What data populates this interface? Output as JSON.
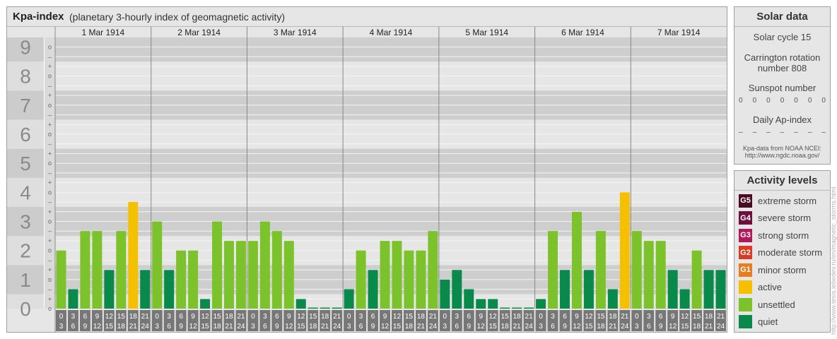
{
  "header": {
    "title": "Kpa-index",
    "subtitle": "(planetary 3-hourly index of geomagnetic activity)"
  },
  "solar": {
    "title": "Solar data",
    "cycle": "Solar cycle 15",
    "carrington_line1": "Carrington rotation",
    "carrington_line2": "number 808",
    "sunspot_label": "Sunspot number",
    "sunspot_values": [
      "0",
      "0",
      "0",
      "0",
      "0",
      "0",
      "0"
    ],
    "ap_label": "Daily Ap-index",
    "ap_values": [
      "–",
      "–",
      "–",
      "–",
      "–",
      "–",
      "–"
    ],
    "source_line1": "Kpa-data from NOAA NCEI:",
    "source_line2": "http://www.ngdc.noaa.gov/"
  },
  "activity": {
    "title": "Activity levels",
    "levels": [
      {
        "badge": "G5",
        "label": "extreme storm",
        "color": "#4a0a24"
      },
      {
        "badge": "G4",
        "label": "severe storm",
        "color": "#6e0f3e"
      },
      {
        "badge": "G3",
        "label": "strong storm",
        "color": "#b0185a"
      },
      {
        "badge": "G2",
        "label": "moderate storm",
        "color": "#d83a22"
      },
      {
        "badge": "G1",
        "label": "minor storm",
        "color": "#e87c1e"
      },
      {
        "badge": "",
        "label": "active",
        "color": "#f5c000"
      },
      {
        "badge": "",
        "label": "unsettled",
        "color": "#7cc22a"
      },
      {
        "badge": "",
        "label": "quiet",
        "color": "#0a8a4a"
      }
    ]
  },
  "credit": "http://www.tesis.lebedev.ru/en/magnetic_storms.html",
  "chart_data": {
    "type": "bar",
    "y_levels": [
      "0",
      "1",
      "2",
      "3",
      "4",
      "5",
      "6",
      "7",
      "8",
      "9"
    ],
    "y_minor_labels": [
      "o",
      "+",
      "–",
      "o",
      "+",
      "–",
      "o",
      "+",
      "–",
      "o",
      "+",
      "–",
      "o",
      "+",
      "–",
      "o",
      "+",
      "–",
      "o",
      "+",
      "–",
      "o",
      "+",
      "–",
      "o",
      "+",
      "–",
      "o"
    ],
    "ylim": [
      0,
      9.33
    ],
    "interval_start_labels": [
      "0",
      "3",
      "6",
      "9",
      "12",
      "15",
      "18",
      "21"
    ],
    "interval_end_labels": [
      "3",
      "6",
      "9",
      "12",
      "15",
      "18",
      "21",
      "24"
    ],
    "colors": {
      "quiet": "#0a8a4a",
      "unsettled": "#7cc22a",
      "active": "#f5c000"
    },
    "days": [
      {
        "date": "1 Mar 1914",
        "kp": [
          2.0,
          0.67,
          2.67,
          2.67,
          1.33,
          2.67,
          3.67,
          1.33
        ]
      },
      {
        "date": "2 Mar 1914",
        "kp": [
          3.0,
          1.33,
          2.0,
          2.0,
          0.33,
          3.0,
          2.33,
          2.33
        ]
      },
      {
        "date": "3 Mar 1914",
        "kp": [
          2.33,
          3.0,
          2.67,
          2.33,
          0.33,
          0.0,
          0.0,
          0.0
        ]
      },
      {
        "date": "4 Mar 1914",
        "kp": [
          0.67,
          2.0,
          1.33,
          2.33,
          2.33,
          2.0,
          2.0,
          2.67
        ]
      },
      {
        "date": "5 Mar 1914",
        "kp": [
          1.0,
          1.33,
          0.67,
          0.33,
          0.33,
          0.0,
          0.0,
          0.0
        ]
      },
      {
        "date": "6 Mar 1914",
        "kp": [
          0.33,
          2.67,
          1.33,
          3.33,
          1.33,
          2.67,
          0.67,
          4.0
        ]
      },
      {
        "date": "7 Mar 1914",
        "kp": [
          2.67,
          2.33,
          2.33,
          1.33,
          0.67,
          2.0,
          1.33,
          1.33
        ]
      }
    ]
  }
}
